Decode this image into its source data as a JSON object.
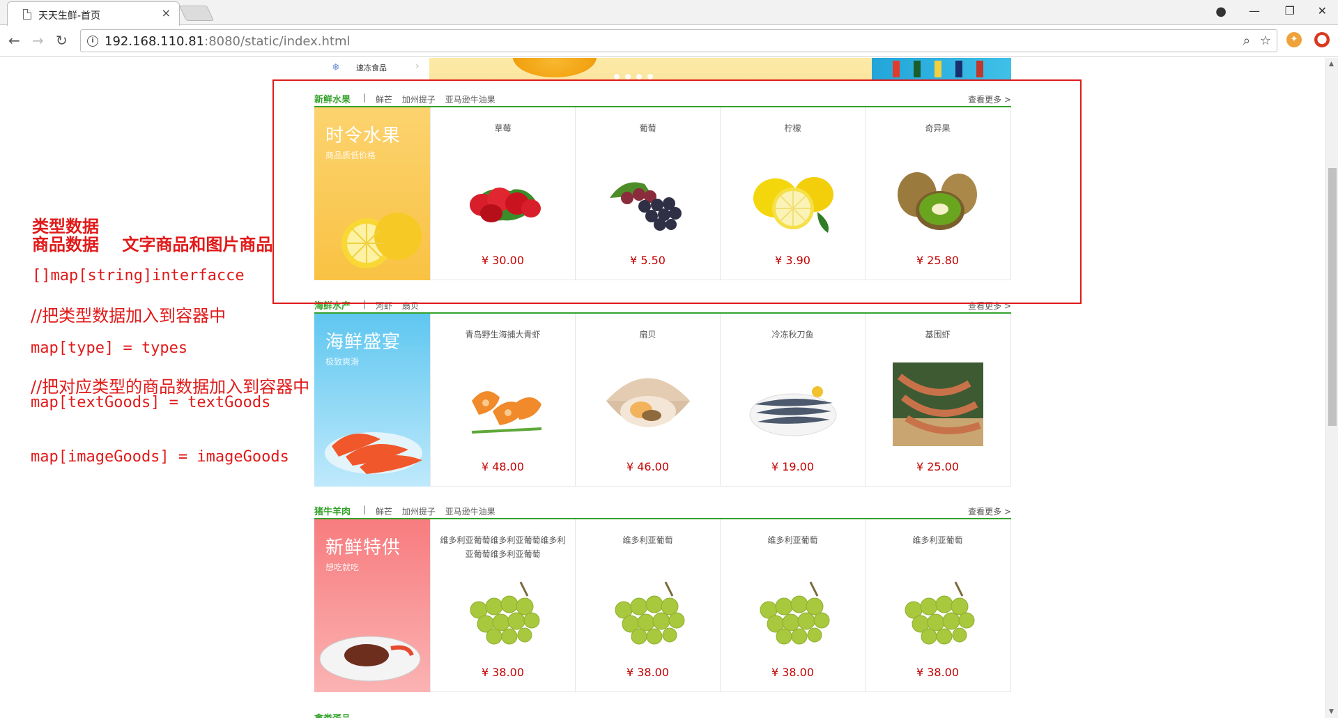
{
  "browser": {
    "tab_title": "天天生鲜-首页",
    "tab_close": "×",
    "url_host": "192.168.110.81",
    "url_rest": ":8080/static/index.html",
    "info_glyph": "i"
  },
  "top_menu": {
    "item_label": "速冻食品"
  },
  "floors": [
    {
      "title": "新鲜水果",
      "tags": [
        "鲜芒",
        "加州提子",
        "亚马逊牛油果"
      ],
      "more": "查看更多 >",
      "banner_title": "时令水果",
      "banner_sub": "商品质低价格",
      "goods": [
        {
          "name": "草莓",
          "price": "¥ 30.00"
        },
        {
          "name": "葡萄",
          "price": "¥ 5.50"
        },
        {
          "name": "柠檬",
          "price": "¥ 3.90"
        },
        {
          "name": "奇异果",
          "price": "¥ 25.80"
        }
      ]
    },
    {
      "title": "海鲜水产",
      "tags": [
        "河虾",
        "扇贝"
      ],
      "more": "查看更多 >",
      "banner_title": "海鲜盛宴",
      "banner_sub": "极致爽滑",
      "goods": [
        {
          "name": "青岛野生海捕大青虾",
          "price": "¥ 48.00"
        },
        {
          "name": "扇贝",
          "price": "¥ 46.00"
        },
        {
          "name": "冷冻秋刀鱼",
          "price": "¥ 19.00"
        },
        {
          "name": "基围虾",
          "price": "¥ 25.00"
        }
      ]
    },
    {
      "title": "猪牛羊肉",
      "tags": [
        "鲜芒",
        "加州提子",
        "亚马逊牛油果"
      ],
      "more": "查看更多 >",
      "banner_title": "新鲜特供",
      "banner_sub": "想吃就吃",
      "goods": [
        {
          "name": "维多利亚葡萄维多利亚葡萄维多利亚葡萄维多利亚葡萄",
          "price": "¥ 38.00"
        },
        {
          "name": "维多利亚葡萄",
          "price": "¥ 38.00"
        },
        {
          "name": "维多利亚葡萄",
          "price": "¥ 38.00"
        },
        {
          "name": "维多利亚葡萄",
          "price": "¥ 38.00"
        }
      ]
    },
    {
      "title": "禽类蛋品"
    }
  ],
  "annotations": {
    "line1": "类型数据",
    "line2": "商品数据    文字商品和图片商品",
    "line3": "[]map[string]interfacce",
    "line4": "//把类型数据加入到容器中",
    "line5": "map[type] = types",
    "line6": "//把对应类型的商品数据加入到容器中",
    "line7": "map[textGoods] = textGoods",
    "line8": "map[imageGoods] = imageGoods"
  },
  "colors": {
    "accent_green": "#35a22c",
    "price_red": "#c40000",
    "annotation_red": "#e11a1a"
  }
}
